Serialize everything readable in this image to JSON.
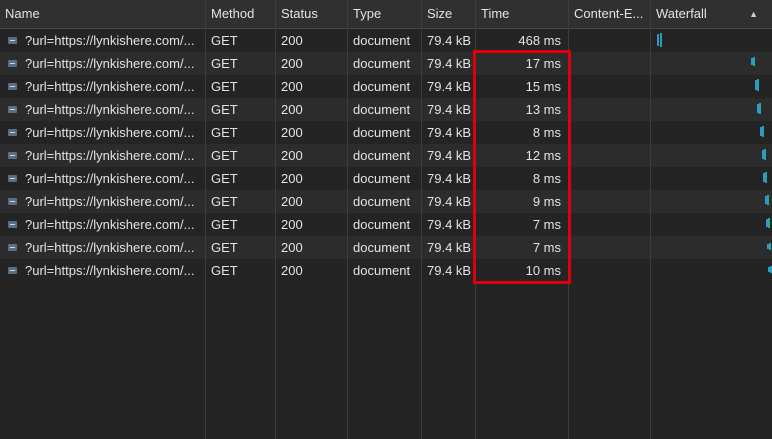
{
  "columns": {
    "name": "Name",
    "method": "Method",
    "status": "Status",
    "type": "Type",
    "size": "Size",
    "time": "Time",
    "content_encoding": "Content-E...",
    "waterfall": "Waterfall"
  },
  "sort_indicator": "▲",
  "requests": [
    {
      "name": "?url=https://lynkishere.com/...",
      "method": "GET",
      "status": "200",
      "type": "document",
      "size": "79.4 kB",
      "time": "468 ms",
      "content_encoding": ""
    },
    {
      "name": "?url=https://lynkishere.com/...",
      "method": "GET",
      "status": "200",
      "type": "document",
      "size": "79.4 kB",
      "time": "17 ms",
      "content_encoding": ""
    },
    {
      "name": "?url=https://lynkishere.com/...",
      "method": "GET",
      "status": "200",
      "type": "document",
      "size": "79.4 kB",
      "time": "15 ms",
      "content_encoding": ""
    },
    {
      "name": "?url=https://lynkishere.com/...",
      "method": "GET",
      "status": "200",
      "type": "document",
      "size": "79.4 kB",
      "time": "13 ms",
      "content_encoding": ""
    },
    {
      "name": "?url=https://lynkishere.com/...",
      "method": "GET",
      "status": "200",
      "type": "document",
      "size": "79.4 kB",
      "time": "8 ms",
      "content_encoding": ""
    },
    {
      "name": "?url=https://lynkishere.com/...",
      "method": "GET",
      "status": "200",
      "type": "document",
      "size": "79.4 kB",
      "time": "12 ms",
      "content_encoding": ""
    },
    {
      "name": "?url=https://lynkishere.com/...",
      "method": "GET",
      "status": "200",
      "type": "document",
      "size": "79.4 kB",
      "time": "8 ms",
      "content_encoding": ""
    },
    {
      "name": "?url=https://lynkishere.com/...",
      "method": "GET",
      "status": "200",
      "type": "document",
      "size": "79.4 kB",
      "time": "9 ms",
      "content_encoding": ""
    },
    {
      "name": "?url=https://lynkishere.com/...",
      "method": "GET",
      "status": "200",
      "type": "document",
      "size": "79.4 kB",
      "time": "7 ms",
      "content_encoding": ""
    },
    {
      "name": "?url=https://lynkishere.com/...",
      "method": "GET",
      "status": "200",
      "type": "document",
      "size": "79.4 kB",
      "time": "7 ms",
      "content_encoding": ""
    },
    {
      "name": "?url=https://lynkishere.com/...",
      "method": "GET",
      "status": "200",
      "type": "document",
      "size": "79.4 kB",
      "time": "10 ms",
      "content_encoding": ""
    }
  ],
  "colors": {
    "highlight_border": "#e0000d",
    "waterfall_waiting": "#1fa9a0",
    "waterfall_download": "#3b8fd8"
  }
}
